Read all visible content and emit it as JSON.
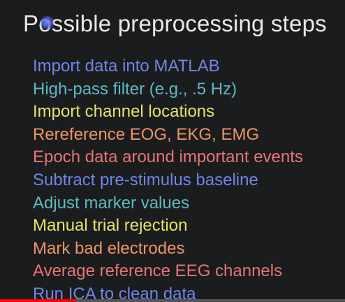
{
  "slide": {
    "title": "Possible preprocessing steps",
    "steps": [
      {
        "text": "Import data into MATLAB",
        "color": "#6f86e6"
      },
      {
        "text": "High-pass filter (e.g., .5 Hz)",
        "color": "#5fb8c4"
      },
      {
        "text": "Import channel locations",
        "color": "#e4e36a"
      },
      {
        "text": "Rereference EOG, EKG, EMG",
        "color": "#ee9368"
      },
      {
        "text": "Epoch data around important events",
        "color": "#e77573"
      },
      {
        "text": "Subtract pre-stimulus baseline",
        "color": "#6f86e6"
      },
      {
        "text": "Adjust marker values",
        "color": "#5fb8c4"
      },
      {
        "text": "Manual trial rejection",
        "color": "#e4e36a"
      },
      {
        "text": "Mark bad electrodes",
        "color": "#ee9368"
      },
      {
        "text": "Average reference EEG channels",
        "color": "#e77573"
      },
      {
        "text": "Run ICA to clean data",
        "color": "#6f86e6"
      }
    ]
  },
  "player": {
    "progress_percent": 22,
    "progress_color": "#ff0000"
  }
}
